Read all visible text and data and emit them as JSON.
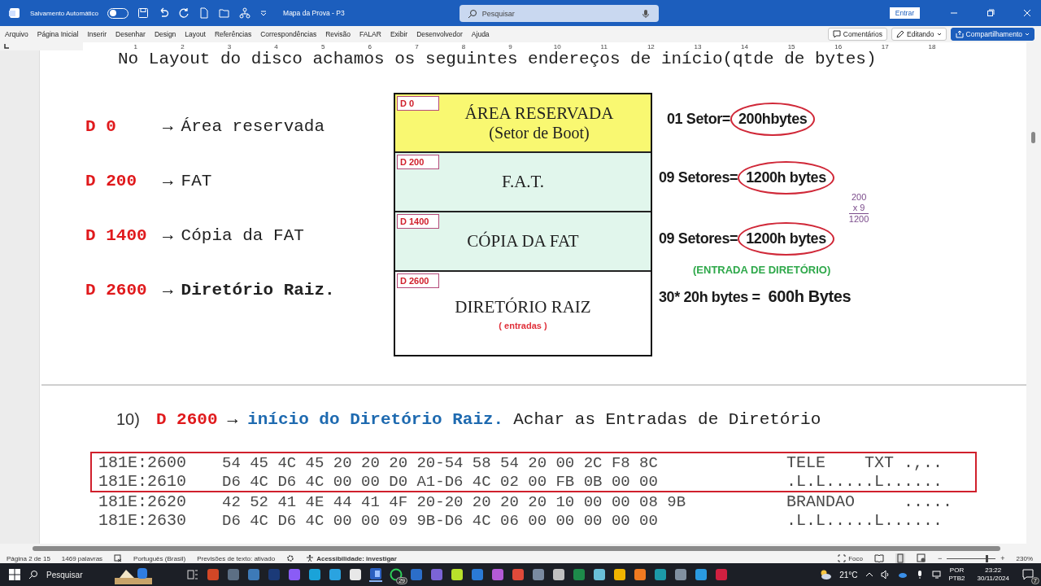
{
  "title_bar": {
    "autosave_label": "Salvamento Automático",
    "autosave_on": false,
    "document_title": "Mapa da Prova - P3",
    "search_placeholder": "Pesquisar",
    "sign_in": "Entrar"
  },
  "menu": [
    "Arquivo",
    "Página Inicial",
    "Inserir",
    "Desenhar",
    "Design",
    "Layout",
    "Referências",
    "Correspondências",
    "Revisão",
    "FALAR",
    "Exibir",
    "Desenvolvedor",
    "Ajuda"
  ],
  "ribbon_buttons": [
    {
      "label": "Comentários",
      "kind": "comment"
    },
    {
      "label": "Editando",
      "kind": "edit"
    },
    {
      "label": "Compartilhamento",
      "kind": "share"
    }
  ],
  "ruler": [
    "1",
    "2",
    "3",
    "4",
    "5",
    "6",
    "7",
    "8",
    "9",
    "10",
    "11",
    "12",
    "13",
    "14",
    "15",
    "16",
    "17",
    "18"
  ],
  "document": {
    "heading": "No Layout do disco achamos os seguintes endereços de início(qtde de bytes)",
    "addresses": [
      {
        "address": "D 0",
        "arrow": "→",
        "target": "Área reservada",
        "bold": false
      },
      {
        "address": "D 200",
        "arrow": "→",
        "target": "FAT",
        "bold": false
      },
      {
        "address": "D 1400",
        "arrow": "→",
        "target": "Cópia da FAT",
        "bold": false
      },
      {
        "address": "D 2600",
        "arrow": "→",
        "target": "Diretório Raiz.",
        "bold": true
      }
    ],
    "disk_map": [
      {
        "tag": "D 0",
        "title": "ÁREA RESERVADA",
        "subtitle": "(Setor de Boot)",
        "color": "#f9f871"
      },
      {
        "tag": "D 200",
        "title": "F.A.T.",
        "color": "#e1f6ec"
      },
      {
        "tag": "D 1400",
        "title": "CÓPIA DA FAT",
        "color": "#e1f6ec"
      },
      {
        "tag": "D 2600",
        "title": "DIRETÓRIO RAIZ",
        "note": "( entradas )",
        "color": "#ffffff"
      }
    ],
    "sizes": [
      {
        "label": "01 Setor=",
        "value": "200hbytes"
      },
      {
        "label": "09 Setores=",
        "value": "1200h bytes"
      },
      {
        "label": "09 Setores=",
        "value": "1200h bytes"
      }
    ],
    "calc": [
      "200",
      "x 9",
      "1200"
    ],
    "entry_label": "(ENTRADA DE DIRETÓRIO)",
    "dir_size": {
      "label": "30* 20h bytes =",
      "value": "600h  Bytes"
    },
    "step": {
      "number": "10)",
      "address": "D 2600",
      "arrow": "→",
      "link_text": "início do Diretório Raiz.",
      "rest": "Achar as Entradas de Diretório"
    },
    "hex_rows": [
      {
        "address": "181E:2600",
        "bytes": "54 45 4C 45 20 20 20 20-54 58 54 20 00 2C F8 8C",
        "ascii": "TELE    TXT .,..",
        "highlighted": true
      },
      {
        "address": "181E:2610",
        "bytes": "D6 4C D6 4C 00 00 D0 A1-D6 4C 02 00 FB 0B 00 00",
        "ascii": ".L.L.....L......",
        "highlighted": true
      },
      {
        "address": "181E:2620",
        "bytes": "42 52 41 4E 44 41 4F 20-20 20 20 20 10 00 00 08 9B",
        "ascii": "BRANDAO     .....",
        "highlighted": false
      },
      {
        "address": "181E:2630",
        "bytes": "D6 4C D6 4C 00 00 09 9B-D6 4C 06 00 00 00 00 00",
        "ascii": ".L.L.....L......",
        "highlighted": false
      }
    ]
  },
  "status_bar": {
    "page": "Página 2 de 15",
    "words": "1469 palavras",
    "language": "Português (Brasil)",
    "predictions": "Previsões de texto: ativado",
    "accessibility": "Acessibilidade: investigar",
    "focus": "Foco",
    "zoom_out": "−",
    "zoom_in": "+",
    "zoom_slider": {
      "level": 0.8
    },
    "zoom": "230%"
  },
  "taskbar": {
    "search_placeholder": "Pesquisar",
    "chat_badge": "29",
    "weather": "21°C",
    "language": [
      "POR",
      "PTB2"
    ],
    "time": "23:22",
    "date": "30/11/2024",
    "notifications": "7"
  }
}
